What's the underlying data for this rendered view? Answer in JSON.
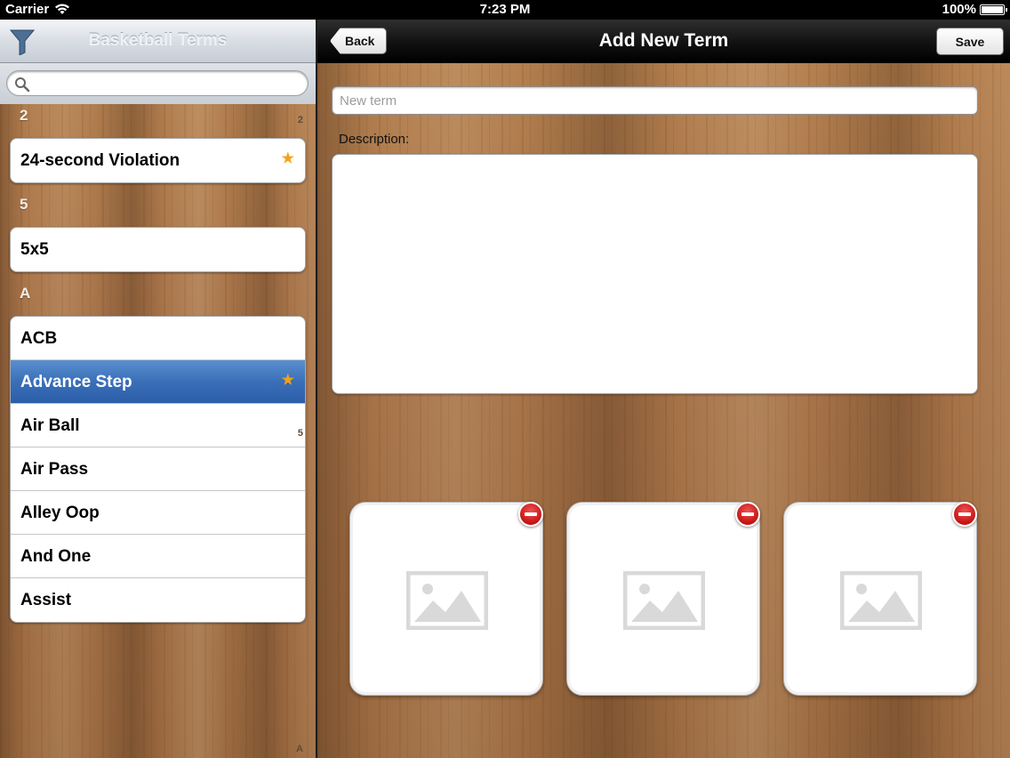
{
  "status_bar": {
    "carrier": "Carrier",
    "time": "7:23 PM",
    "battery": "100%"
  },
  "left_panel": {
    "title": "Basketball Terms",
    "search": {
      "value": "",
      "placeholder": ""
    },
    "sections": [
      {
        "header": "2",
        "items": [
          {
            "label": "24-second Violation",
            "favorite": true
          }
        ]
      },
      {
        "header": "5",
        "items": [
          {
            "label": "5x5",
            "favorite": false
          }
        ]
      },
      {
        "header": "A",
        "items": [
          {
            "label": "ACB",
            "favorite": false
          },
          {
            "label": "Advance Step",
            "favorite": true,
            "selected": true
          },
          {
            "label": "Air Ball",
            "favorite": false
          },
          {
            "label": "Air Pass",
            "favorite": false
          },
          {
            "label": "Alley Oop",
            "favorite": false
          },
          {
            "label": "And One",
            "favorite": false
          },
          {
            "label": "Assist",
            "favorite": false
          }
        ]
      }
    ],
    "index": [
      "2",
      "5",
      "A"
    ]
  },
  "right_panel": {
    "title": "Add New Term",
    "back_label": "Back",
    "save_label": "Save",
    "term_placeholder": "New term",
    "description_label": "Description:",
    "photo_slots": 3
  },
  "colors": {
    "favorite_star": "#f2a31b",
    "selected_row": "#3a6fb8",
    "remove_badge": "#d42020"
  },
  "icons": {
    "filter": "filter-icon",
    "search": "search-icon",
    "star": "star-icon",
    "remove": "remove-icon",
    "image": "image-placeholder-icon"
  }
}
